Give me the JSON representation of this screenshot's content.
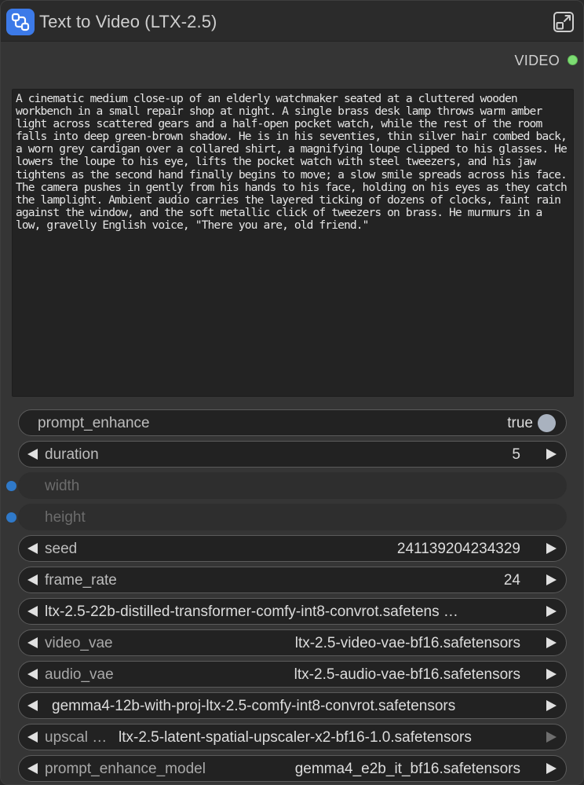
{
  "node": {
    "title": "Text to Video (LTX-2.5)",
    "icon": "workflow-icon",
    "expand_icon": "expand-icon",
    "output": {
      "label": "VIDEO",
      "color": "#7ddd73"
    }
  },
  "prompt": {
    "text": "A cinematic medium close-up of an elderly watchmaker seated at a cluttered wooden workbench in a small repair shop at night. A single brass desk lamp throws warm amber light across scattered gears and a half-open pocket watch, while the rest of the room falls into deep green-brown shadow. He is in his seventies, thin silver hair combed back, a worn grey cardigan over a collared shirt, a magnifying loupe clipped to his glasses. He lowers the loupe to his eye, lifts the pocket watch with steel tweezers, and his jaw tightens as the second hand finally begins to move; a slow smile spreads across his face. The camera pushes in gently from his hands to his face, holding on his eyes as they catch the lamplight. Ambient audio carries the layered ticking of dozens of clocks, faint rain against the window, and the soft metallic click of tweezers on brass. He murmurs in a low, gravelly English voice, \"There you are, old friend.\""
  },
  "widgets": {
    "prompt_enhance": {
      "label": "prompt_enhance",
      "value": "true"
    },
    "duration": {
      "label": "duration",
      "value": "5"
    },
    "width": {
      "label": "width"
    },
    "height": {
      "label": "height"
    },
    "seed": {
      "label": "seed",
      "value": "241139204234329"
    },
    "frame_rate": {
      "label": "frame_rate",
      "value": "24"
    },
    "model": {
      "value": "ltx-2.5-22b-distilled-transformer-comfy-int8-convrot.safetens …"
    },
    "video_vae": {
      "label": "video_vae",
      "value": "ltx-2.5-video-vae-bf16.safetensors"
    },
    "audio_vae": {
      "label": "audio_vae",
      "value": "ltx-2.5-audio-vae-bf16.safetensors"
    },
    "text_encoder": {
      "value": "gemma4-12b-with-proj-ltx-2.5-comfy-int8-convrot.safetensors"
    },
    "upscaler": {
      "label": "upscal  …",
      "value": "ltx-2.5-latent-spatial-upscaler-x2-bf16-1.0.safetensors"
    },
    "prompt_enhance_model": {
      "label": "prompt_enhance_model",
      "value": "gemma4_e2b_it_bf16.safetensors"
    }
  },
  "colors": {
    "accent": "#3c7ae8",
    "input_dot": "#2f79c9",
    "toggle_knob": "#a9b2bf"
  }
}
